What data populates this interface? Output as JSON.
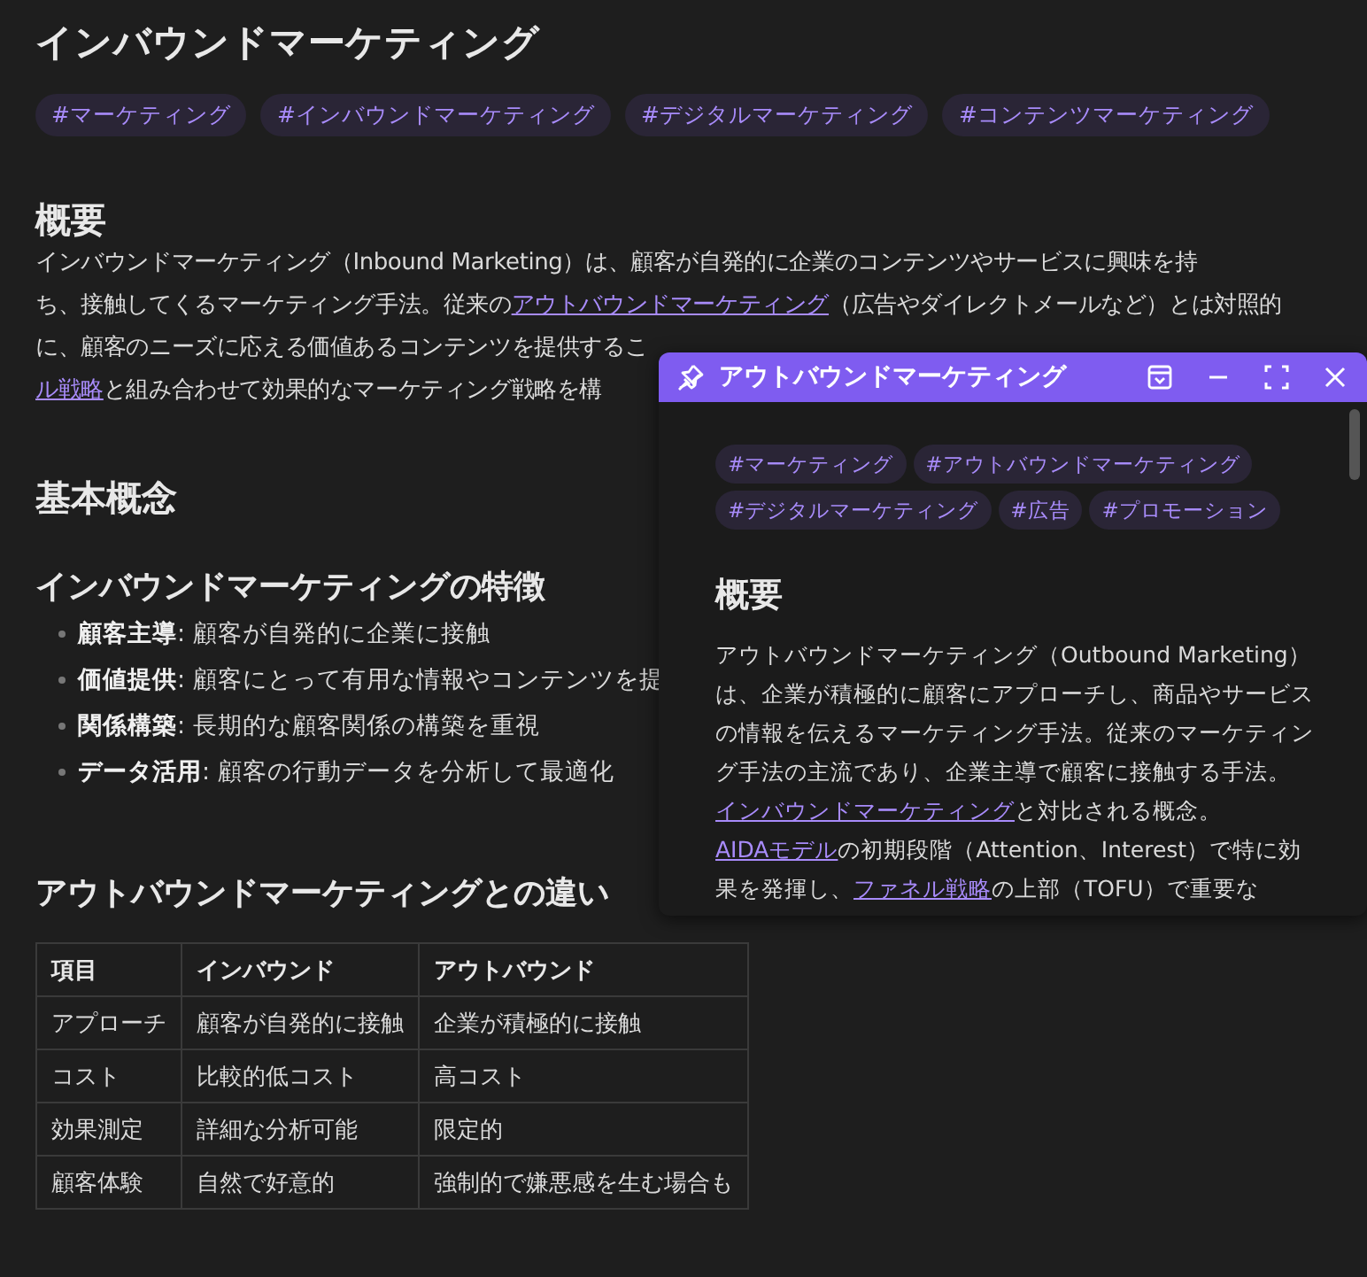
{
  "title": "インバウンドマーケティング",
  "tags": [
    "#マーケティング",
    "#インバウンドマーケティング",
    "#デジタルマーケティング",
    "#コンテンツマーケティング"
  ],
  "overview": {
    "heading": "概要",
    "lines": [
      [
        {
          "kind": "text",
          "text": "インバウンドマーケティング（Inbound Marketing）は、顧客が自発的に企業のコンテンツやサービスに興味を持"
        }
      ],
      [
        {
          "kind": "text",
          "text": "ち、接触してくるマーケティング手法。従来の"
        },
        {
          "kind": "link",
          "text": "アウトバウンドマーケティング"
        },
        {
          "kind": "text",
          "text": "（広告やダイレクトメールなど）とは対照的"
        }
      ],
      [
        {
          "kind": "text",
          "text": "に、顧客のニーズに応える価値あるコンテンツを提供するこ"
        }
      ],
      [
        {
          "kind": "link",
          "text": "ル戦略"
        },
        {
          "kind": "text",
          "text": "と組み合わせて効果的なマーケティング戦略を構"
        }
      ]
    ]
  },
  "basics": {
    "heading": "基本概念",
    "subheading": "インバウンドマーケティングの特徴",
    "bullets": [
      {
        "term": "顧客主導",
        "text": ": 顧客が自発的に企業に接触"
      },
      {
        "term": "価値提供",
        "text": ": 顧客にとって有用な情報やコンテンツを提"
      },
      {
        "term": "関係構築",
        "text": ": 長期的な顧客関係の構築を重視"
      },
      {
        "term": "データ活用",
        "text": ": 顧客の行動データを分析して最適化"
      }
    ]
  },
  "comparison": {
    "heading": "アウトバウンドマーケティングとの違い",
    "table": {
      "columns": [
        "項目",
        "インバウンド",
        "アウトバウンド"
      ],
      "rows": [
        [
          "アプローチ",
          "顧客が自発的に接触",
          "企業が積極的に接触"
        ],
        [
          "コスト",
          "比較的低コスト",
          "高コスト"
        ],
        [
          "効果測定",
          "詳細な分析可能",
          "限定的"
        ],
        [
          "顧客体験",
          "自然で好意的",
          "強制的で嫌悪感を生む場合も"
        ]
      ]
    }
  },
  "popup": {
    "title": "アウトバウンドマーケティング",
    "tags": [
      "#マーケティング",
      "#アウトバウンドマーケティング",
      "#デジタルマーケティング",
      "#広告",
      "#プロモーション"
    ],
    "heading": "概要",
    "paragraph": [
      {
        "kind": "text",
        "text": "アウトバウンドマーケティング（Outbound Marketing）は、企業が積極的に顧客にアプローチし、商品やサービスの情報を伝えるマーケティング手法。従来のマーケティング手法の主流であり、企業主導で顧客に接触する手法。"
      },
      {
        "kind": "link",
        "text": "インバウンドマーケティング"
      },
      {
        "kind": "text",
        "text": "と対比される概念。"
      },
      {
        "kind": "link",
        "text": "AIDAモデル"
      },
      {
        "kind": "text",
        "text": "の初期段階（Attention、Interest）で特に効果を発揮し、"
      },
      {
        "kind": "link",
        "text": "ファネル戦略"
      },
      {
        "kind": "text",
        "text": "の上部（TOFU）で重要な"
      }
    ]
  }
}
